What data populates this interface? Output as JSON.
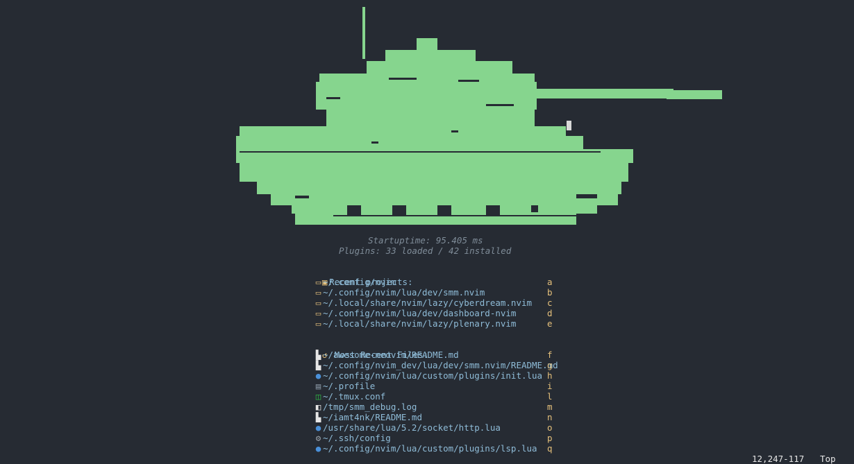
{
  "stats": {
    "startuptime": "Startuptime: 95.405 ms",
    "plugins": "Plugins: 33 loaded / 42 installed"
  },
  "recent_projects": {
    "header": "Recent projects:",
    "icon": "folder-icon",
    "items": [
      {
        "path": "~/.config/nvim",
        "key": "a",
        "icon": "project-icon"
      },
      {
        "path": "~/.config/nvim/lua/dev/smm.nvim",
        "key": "b",
        "icon": "project-icon"
      },
      {
        "path": "~/.local/share/nvim/lazy/cyberdream.nvim",
        "key": "c",
        "icon": "project-icon"
      },
      {
        "path": "~/.config/nvim/lua/dev/dashboard-nvim",
        "key": "d",
        "icon": "project-icon"
      },
      {
        "path": "~/.local/share/nvim/lazy/plenary.nvim",
        "key": "e",
        "icon": "project-icon"
      }
    ]
  },
  "recent_files": {
    "header": "Most Recent Files:",
    "icon": "history-icon",
    "items": [
      {
        "path": "~/awesome-neovim/README.md",
        "key": "f",
        "icon": "markdown-icon"
      },
      {
        "path": "~/.config/nvim_dev/lua/dev/smm.nvim/README.md",
        "key": "g",
        "icon": "markdown-icon"
      },
      {
        "path": "~/.config/nvim/lua/custom/plugins/init.lua",
        "key": "h",
        "icon": "lua-icon"
      },
      {
        "path": "~/.profile",
        "key": "i",
        "icon": "file-icon"
      },
      {
        "path": "~/.tmux.conf",
        "key": "l",
        "icon": "tmux-icon"
      },
      {
        "path": "/tmp/smm_debug.log",
        "key": "m",
        "icon": "log-icon"
      },
      {
        "path": "~/iamt4nk/README.md",
        "key": "n",
        "icon": "markdown-icon"
      },
      {
        "path": "/usr/share/lua/5.2/socket/http.lua",
        "key": "o",
        "icon": "lua-icon"
      },
      {
        "path": "~/.ssh/config",
        "key": "p",
        "icon": "gear-icon"
      },
      {
        "path": "~/.config/nvim/lua/custom/plugins/lsp.lua",
        "key": "q",
        "icon": "lua-icon"
      }
    ]
  },
  "statusline": {
    "position": "12,247-117",
    "scroll": "Top"
  },
  "colors": {
    "background": "#262b33",
    "tank": "#86d58e",
    "accent": "#e5c07b",
    "path": "#8fbcd8"
  }
}
